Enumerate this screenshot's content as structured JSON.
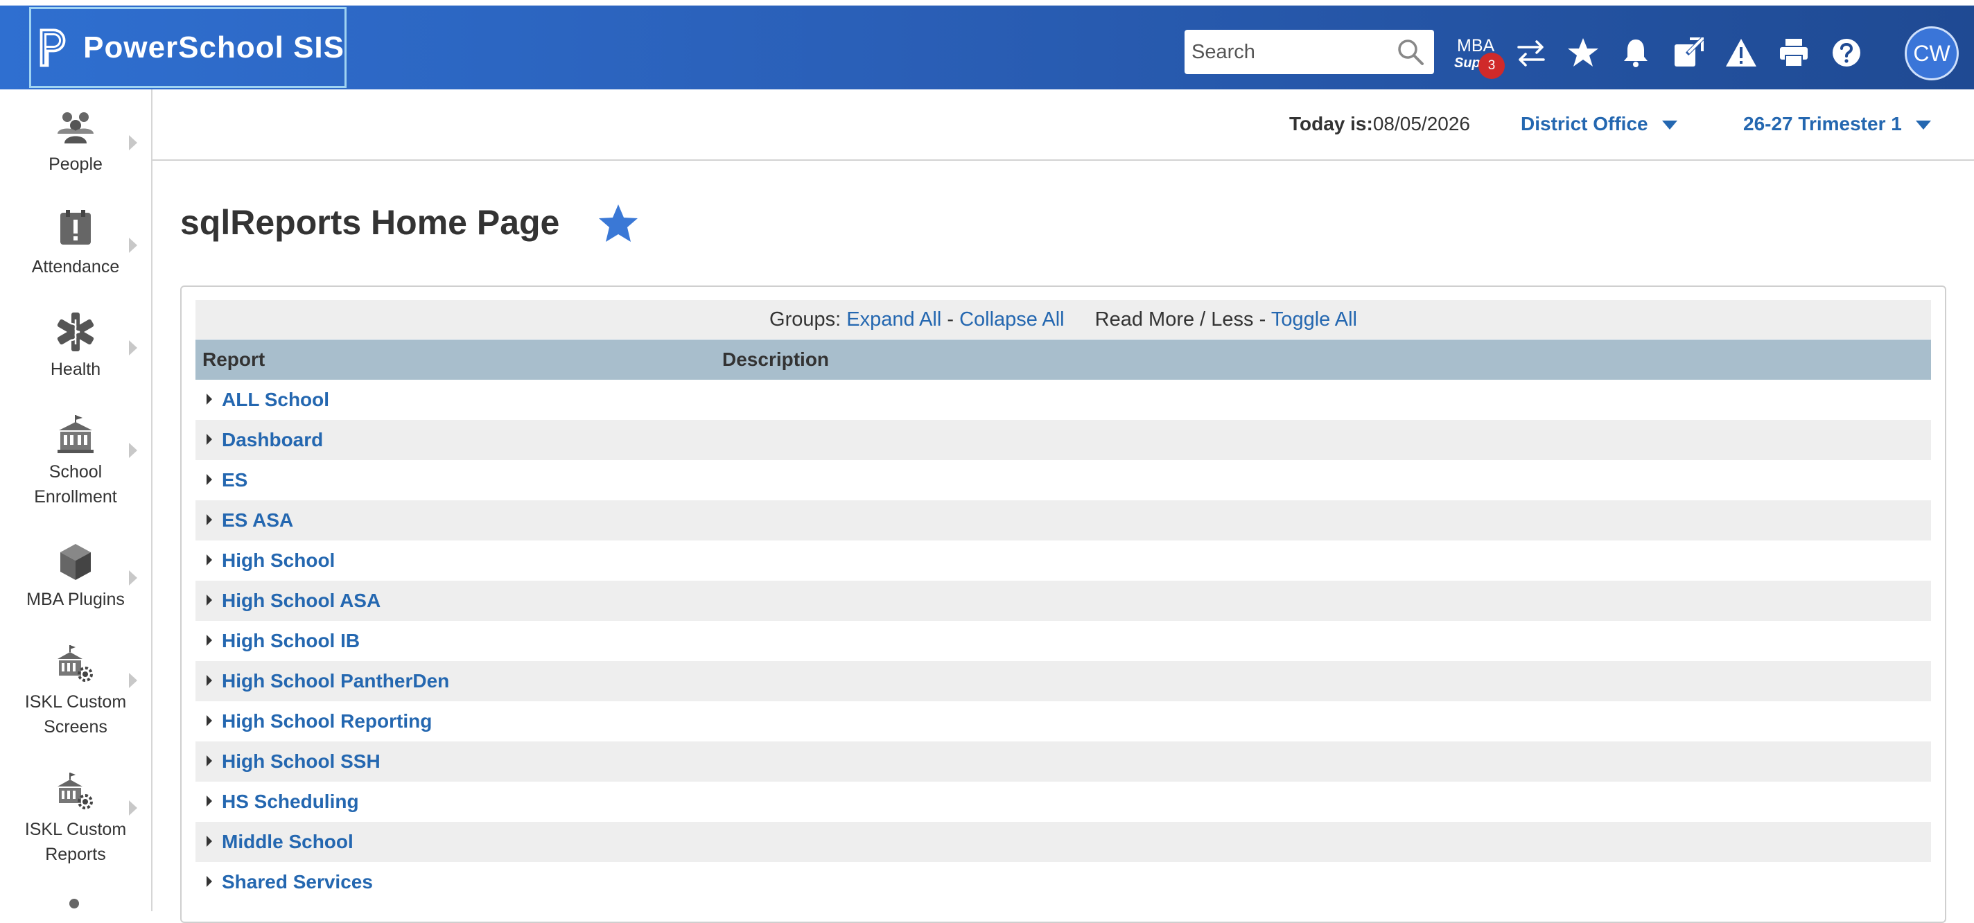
{
  "header": {
    "brand": "PowerSchool SIS",
    "search_placeholder": "Search",
    "mba_line1": "MBA",
    "mba_line2": "Supp",
    "mba_badge": "3",
    "avatar_initials": "CW",
    "colors": {
      "header_start": "#2f6fd0",
      "header_end": "#1f4a93",
      "link": "#2467b0",
      "badge": "#d02a2a"
    }
  },
  "sidebar": {
    "items": [
      {
        "label_line1": "People",
        "label_line2": "",
        "icon": "people-icon"
      },
      {
        "label_line1": "Attendance",
        "label_line2": "",
        "icon": "attendance-icon"
      },
      {
        "label_line1": "Health",
        "label_line2": "",
        "icon": "health-icon"
      },
      {
        "label_line1": "School",
        "label_line2": "Enrollment",
        "icon": "school-icon"
      },
      {
        "label_line1": "MBA Plugins",
        "label_line2": "",
        "icon": "cube-icon"
      },
      {
        "label_line1": "ISKL Custom",
        "label_line2": "Screens",
        "icon": "custom-screens-icon"
      },
      {
        "label_line1": "ISKL Custom",
        "label_line2": "Reports",
        "icon": "custom-reports-icon"
      }
    ]
  },
  "infobar": {
    "today_label": "Today is:",
    "today_value": "08/05/2026",
    "school": "District Office",
    "term": "26-27 Trimester 1"
  },
  "main": {
    "title": "sqlReports Home Page",
    "groups_label": "Groups:",
    "expand_all": "Expand All",
    "sep1": " - ",
    "collapse_all": "Collapse All",
    "read_more_label": "Read More / Less -",
    "toggle_all": "Toggle All",
    "table": {
      "col_report": "Report",
      "col_description": "Description",
      "rows": [
        "ALL School",
        "Dashboard",
        "ES",
        "ES ASA",
        "High School",
        "High School ASA",
        "High School IB",
        "High School PantherDen",
        "High School Reporting",
        "High School SSH",
        "HS Scheduling",
        "Middle School",
        "Shared Services"
      ]
    }
  }
}
